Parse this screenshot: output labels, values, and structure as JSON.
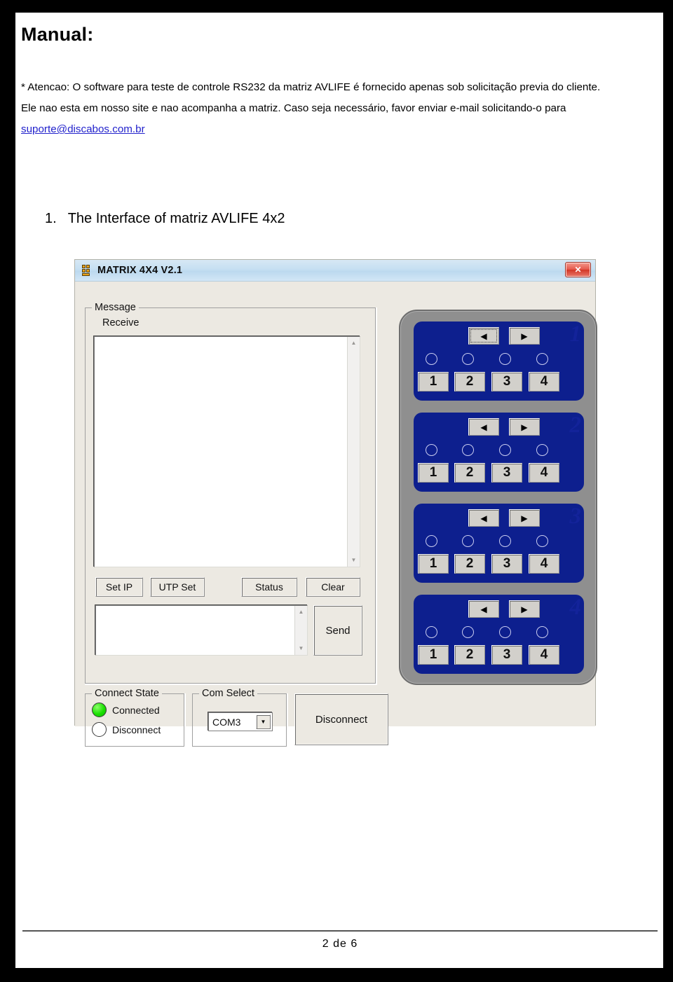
{
  "document": {
    "title": "Manual:",
    "paragraph_lines": [
      "* Atencao: O software para teste de controle RS232 da matriz AVLIFE é fornecido apenas sob solicitação previa do cliente.",
      "Ele nao esta em nosso site e nao acompanha a matriz. Caso seja necessário, favor enviar e-mail solicitando-o para"
    ],
    "email_link": "suporte@discabos.com.br",
    "section": {
      "number": "1.",
      "heading": "The Interface of matriz AVLIFE 4x2"
    },
    "footer": {
      "page_text": "2 de  6"
    }
  },
  "app": {
    "title": "MATRIX 4X4 V2.1",
    "close_label": "✕",
    "groups": {
      "message": {
        "legend": "Message",
        "receive_label": "Receive",
        "receive_value": "",
        "send_value": ""
      },
      "connect_state": {
        "legend": "Connect State",
        "connected_label": "Connected",
        "disconnect_label": "Disconnect",
        "active": "connected"
      },
      "com_select": {
        "legend": "Com Select",
        "value": "COM3",
        "dropdown_glyph": "▼"
      }
    },
    "buttons": {
      "set_ip": "Set IP",
      "utp_set": "UTP Set",
      "status": "Status",
      "clear": "Clear",
      "send": "Send",
      "disconnect": "Disconnect"
    },
    "matrix": {
      "left_arrow": "◀",
      "right_arrow": "▶",
      "rows": [
        {
          "label": "1",
          "outputs": [
            "1",
            "2",
            "3",
            "4"
          ],
          "focused_arrow": "left"
        },
        {
          "label": "2",
          "outputs": [
            "1",
            "2",
            "3",
            "4"
          ],
          "focused_arrow": ""
        },
        {
          "label": "3",
          "outputs": [
            "1",
            "2",
            "3",
            "4"
          ],
          "focused_arrow": ""
        },
        {
          "label": "4",
          "outputs": [
            "1",
            "2",
            "3",
            "4"
          ],
          "focused_arrow": ""
        }
      ]
    }
  },
  "colors": {
    "matrix_blue": "#0d1f8e",
    "panel_gray": "#8f8f8f",
    "link_blue": "#2222cc",
    "led_green": "#19e000",
    "titlebar_blue": "#c5dff2"
  }
}
